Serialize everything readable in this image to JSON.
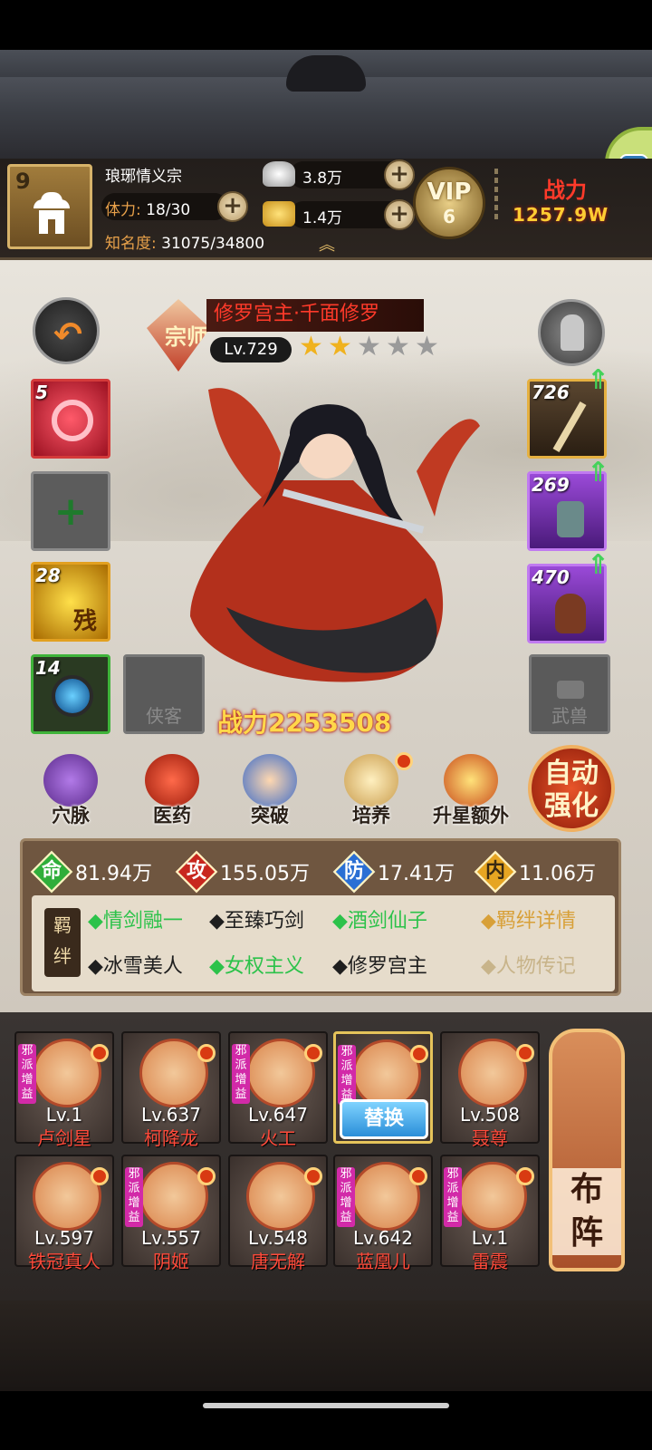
{
  "header": {
    "level": "9",
    "sect_name": "琅琊情义宗",
    "stamina_label": "体力:",
    "stamina_value": "18/30",
    "fame_label": "知名度:",
    "fame_value": "31075/34800",
    "silver": "3.8万",
    "gold": "1.4万",
    "vip_label": "VIP",
    "vip_level": "6",
    "power_label": "战力",
    "power_value": "1257.9W"
  },
  "hero": {
    "badge": "宗师",
    "name": "修罗宫主·千面修罗",
    "level": "Lv.729",
    "stars_filled": 2,
    "stars_total": 5,
    "power": "战力2253508"
  },
  "left_slots": [
    {
      "num": "5",
      "name": "red-swirl-skill"
    },
    {
      "num": "",
      "name": "add-slot"
    },
    {
      "num": "28",
      "name": "gold-rose-skill",
      "glyph": "残"
    },
    {
      "num": "14",
      "name": "blue-orb-skill"
    }
  ],
  "right_slots": [
    {
      "num": "726",
      "name": "bow-equip"
    },
    {
      "num": "269",
      "name": "bracer-equip"
    },
    {
      "num": "470",
      "name": "vase-equip"
    }
  ],
  "empty_slots": {
    "companion": "侠客",
    "beast": "武兽"
  },
  "functions": [
    {
      "label": "穴脉",
      "name": "acupoint"
    },
    {
      "label": "医药",
      "name": "medicine"
    },
    {
      "label": "突破",
      "name": "breakthrough"
    },
    {
      "label": "培养",
      "name": "cultivate"
    },
    {
      "label": "升星额外",
      "name": "star-up-extra"
    }
  ],
  "auto_enhance": "自动强化",
  "attributes": [
    {
      "glyph": "命",
      "value": "81.94万",
      "color": "#2fae3a"
    },
    {
      "glyph": "攻",
      "value": "155.05万",
      "color": "#c8271e"
    },
    {
      "glyph": "防",
      "value": "17.41万",
      "color": "#2a6fd4"
    },
    {
      "glyph": "内",
      "value": "11.06万",
      "color": "#e6a522"
    }
  ],
  "bonds": {
    "seal": "羁绊",
    "row1": [
      {
        "text": "◆情剑融一",
        "color": "#2cc24a"
      },
      {
        "text": "◆至臻巧剑",
        "color": "#1e1e1e"
      },
      {
        "text": "◆酒剑仙子",
        "color": "#2cc24a"
      }
    ],
    "row2": [
      {
        "text": "◆冰雪美人",
        "color": "#1e1e1e"
      },
      {
        "text": "◆女权主义",
        "color": "#2cc24a"
      },
      {
        "text": "◆修罗宫主",
        "color": "#1e1e1e"
      }
    ],
    "details_link": "◆羁绊详情",
    "bio_link": "◆人物传记"
  },
  "formation": {
    "tag": "邪派增益",
    "swap_label": "替换",
    "button_label": "布阵",
    "row1": [
      {
        "lv": "Lv.1",
        "name": "卢剑星",
        "tag": true
      },
      {
        "lv": "Lv.637",
        "name": "柯降龙",
        "tag": false
      },
      {
        "lv": "Lv.647",
        "name": "火工",
        "tag": true
      },
      {
        "lv": "",
        "name": "",
        "tag": true,
        "selected": true
      },
      {
        "lv": "Lv.508",
        "name": "聂尊",
        "tag": false
      }
    ],
    "row2": [
      {
        "lv": "Lv.597",
        "name": "铁冠真人",
        "tag": false
      },
      {
        "lv": "Lv.557",
        "name": "阴姬",
        "tag": true
      },
      {
        "lv": "Lv.548",
        "name": "唐无解",
        "tag": false
      },
      {
        "lv": "Lv.642",
        "name": "蓝凰儿",
        "tag": true
      },
      {
        "lv": "Lv.1",
        "name": "雷震",
        "tag": true
      }
    ]
  }
}
